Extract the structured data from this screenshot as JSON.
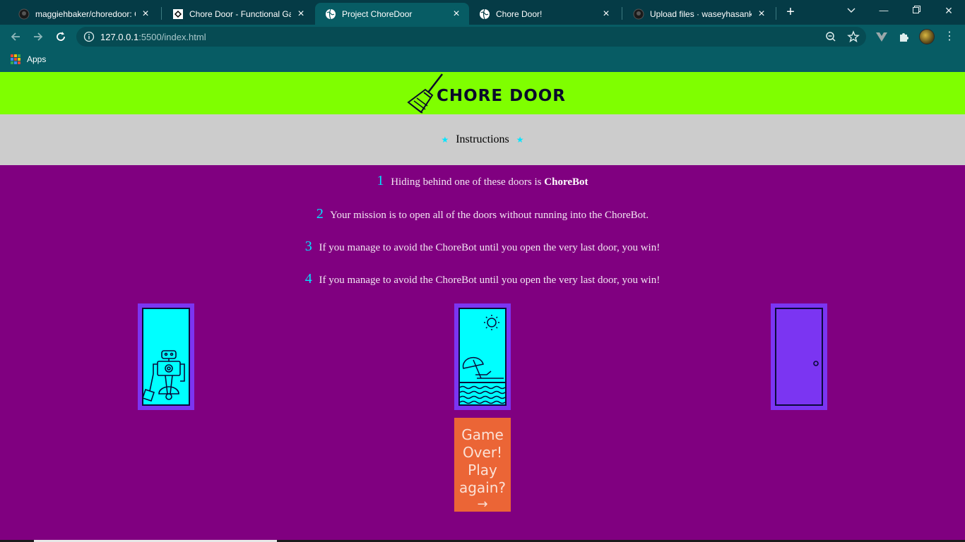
{
  "browser": {
    "tabs": [
      {
        "title": "maggiehbaker/choredoor: Co",
        "icon": "github-icon",
        "active": false
      },
      {
        "title": "Chore Door - Functional Gam",
        "icon": "codecademy-icon",
        "active": false
      },
      {
        "title": "Project ChoreDoor",
        "icon": "globe-icon",
        "active": true
      },
      {
        "title": "Chore Door!",
        "icon": "globe-icon",
        "active": false
      },
      {
        "title": "Upload files · waseyhasankha",
        "icon": "github-icon",
        "active": false
      }
    ],
    "url_host": "127.0.0.1",
    "url_path": ":5500/index.html",
    "bookmarks": {
      "apps_label": "Apps"
    },
    "colors": {
      "frame": "#053b46",
      "toolbar": "#075c64"
    }
  },
  "page": {
    "title": "CHORE DOOR",
    "instructions_heading": "Instructions",
    "steps": [
      {
        "num": "1",
        "text": "Hiding behind one of these doors is ",
        "bold": "ChoreBot"
      },
      {
        "num": "2",
        "text": "Your mission is to open all of the doors without running into the ChoreBot.",
        "bold": ""
      },
      {
        "num": "3",
        "text": "If you manage to avoid the ChoreBot until you open the very last door, you win!",
        "bold": ""
      },
      {
        "num": "4",
        "text": "If you manage to avoid the ChoreBot until you open the very last door, you win!",
        "bold": ""
      }
    ],
    "doors": [
      {
        "state": "open",
        "content": "robot"
      },
      {
        "state": "open",
        "content": "beach"
      },
      {
        "state": "closed",
        "content": "closed-door"
      }
    ],
    "start_button": {
      "text": "Game Over! Play again?",
      "arrow": "→"
    },
    "colors": {
      "header": "#7fff00",
      "instructions_bar": "#cccccc",
      "background": "#800080",
      "door_frame": "#7b35f2",
      "open_door": "#00ffff",
      "accent": "#00e5ff",
      "button": "#eb6536"
    }
  }
}
